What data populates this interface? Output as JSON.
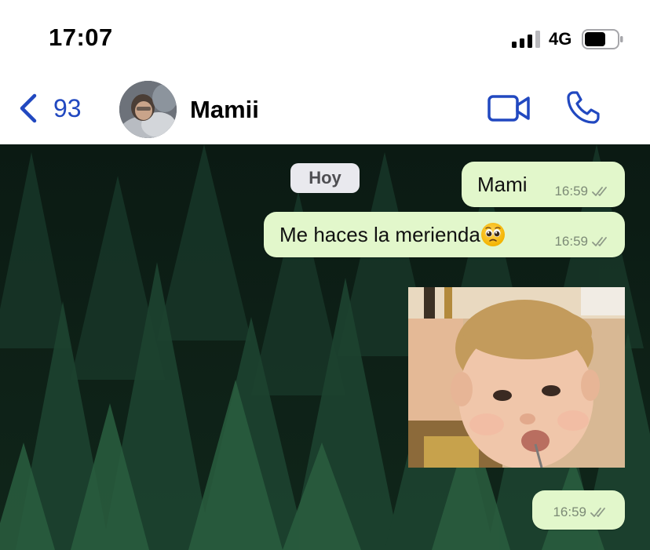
{
  "status_bar": {
    "time": "17:07",
    "network": "4G"
  },
  "header": {
    "back_count": "93",
    "contact_name": "Mamii",
    "icons": {
      "back": "chevron-left-icon",
      "video": "video-camera-icon",
      "call": "phone-icon"
    },
    "accent_color": "#2148c0"
  },
  "chat": {
    "date_label": "Hoy",
    "bubble_color": "#e2f7cb",
    "messages": [
      {
        "type": "text",
        "text": "Mami",
        "time": "16:59",
        "status": "delivered"
      },
      {
        "type": "text",
        "text": "Me haces la merienda",
        "emoji": "pleading-face-emoji",
        "time": "16:59",
        "status": "delivered"
      },
      {
        "type": "image",
        "subject": "toddler-photo"
      },
      {
        "type": "text",
        "text": "",
        "time": "16:59",
        "status": "delivered"
      }
    ]
  }
}
